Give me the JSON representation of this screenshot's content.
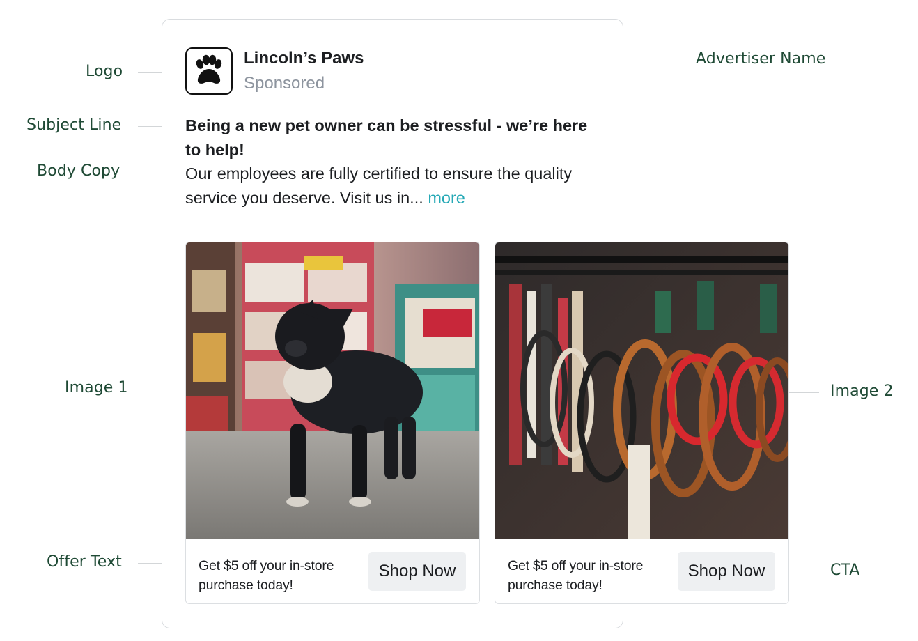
{
  "annotations": {
    "logo": "Logo",
    "subject_line": "Subject Line",
    "body_copy": "Body Copy",
    "image_1": "Image 1",
    "offer_text": "Offer Text",
    "advertiser_name": "Advertiser Name",
    "image_2": "Image 2",
    "cta": "CTA"
  },
  "ad": {
    "advertiser": "Lincoln’s Paws",
    "sponsored": "Sponsored",
    "subject": "Being a new pet owner can be stressful - we’re here to help!",
    "body": "Our employees are fully certified to ensure the quality service you deserve. Visit us in...",
    "more_label": "more",
    "logo_icon": "paw-icon",
    "cards": [
      {
        "image": "french-bulldog-in-pet-store-photo",
        "offer": "Get $5 off your in-store purchase today!",
        "cta": "Shop Now"
      },
      {
        "image": "dog-leashes-on-rack-photo",
        "offer": "Get $5 off your in-store purchase today!",
        "cta": "Shop Now"
      }
    ]
  },
  "colors": {
    "annotation_text": "#1f4a35",
    "more_link": "#26a9b6",
    "cta_background": "#eef0f2"
  }
}
